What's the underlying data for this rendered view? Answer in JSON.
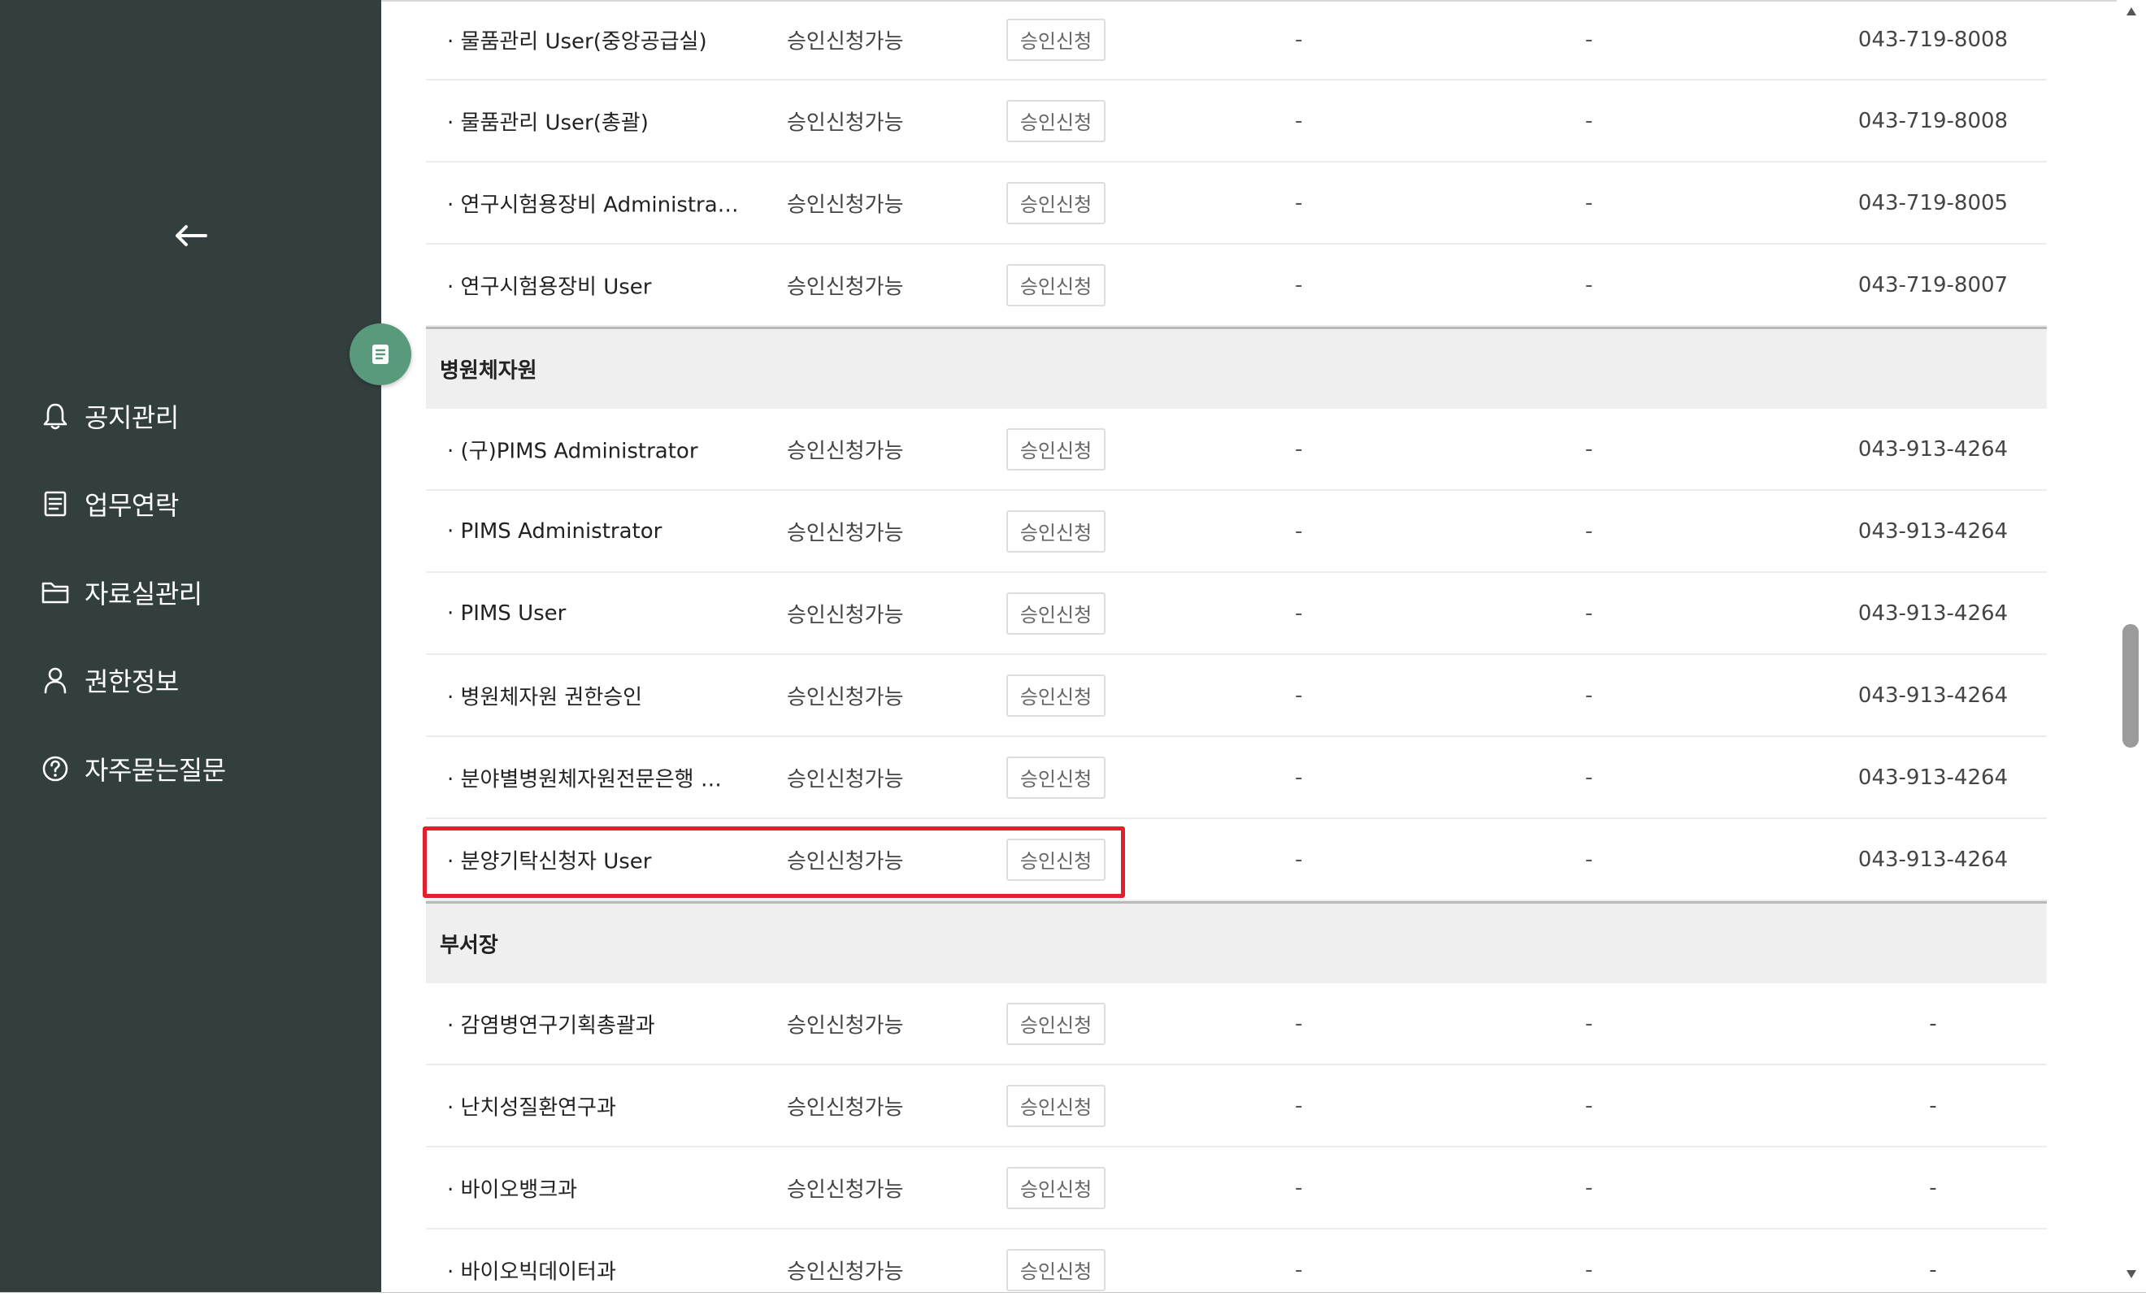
{
  "sidebar": {
    "menu": [
      {
        "label": "공지관리",
        "icon": "bell-icon"
      },
      {
        "label": "업무연락",
        "icon": "document-icon"
      },
      {
        "label": "자료실관리",
        "icon": "folder-icon"
      },
      {
        "label": "권한정보",
        "icon": "user-icon"
      },
      {
        "label": "자주묻는질문",
        "icon": "question-circle-icon"
      }
    ]
  },
  "table": {
    "rows": [
      {
        "type": "item",
        "name": "· 물품관리 User(중앙공급실)",
        "status": "승인신청가능",
        "button": "승인신청",
        "d1": "-",
        "d2": "-",
        "phone": "043-719-8008"
      },
      {
        "type": "item",
        "name": "· 물품관리 User(총괄)",
        "status": "승인신청가능",
        "button": "승인신청",
        "d1": "-",
        "d2": "-",
        "phone": "043-719-8008"
      },
      {
        "type": "item",
        "name": "· 연구시험용장비 Administra…",
        "status": "승인신청가능",
        "button": "승인신청",
        "d1": "-",
        "d2": "-",
        "phone": "043-719-8005"
      },
      {
        "type": "item",
        "name": "· 연구시험용장비 User",
        "status": "승인신청가능",
        "button": "승인신청",
        "d1": "-",
        "d2": "-",
        "phone": "043-719-8007"
      },
      {
        "type": "group",
        "name": "병원체자원"
      },
      {
        "type": "item",
        "name": "· (구)PIMS Administrator",
        "status": "승인신청가능",
        "button": "승인신청",
        "d1": "-",
        "d2": "-",
        "phone": "043-913-4264"
      },
      {
        "type": "item",
        "name": "· PIMS Administrator",
        "status": "승인신청가능",
        "button": "승인신청",
        "d1": "-",
        "d2": "-",
        "phone": "043-913-4264"
      },
      {
        "type": "item",
        "name": "· PIMS User",
        "status": "승인신청가능",
        "button": "승인신청",
        "d1": "-",
        "d2": "-",
        "phone": "043-913-4264"
      },
      {
        "type": "item",
        "name": "· 병원체자원 권한승인",
        "status": "승인신청가능",
        "button": "승인신청",
        "d1": "-",
        "d2": "-",
        "phone": "043-913-4264"
      },
      {
        "type": "item",
        "name": "· 분야별병원체자원전문은행 …",
        "status": "승인신청가능",
        "button": "승인신청",
        "d1": "-",
        "d2": "-",
        "phone": "043-913-4264"
      },
      {
        "type": "item",
        "name": "· 분양기탁신청자 User",
        "status": "승인신청가능",
        "button": "승인신청",
        "d1": "-",
        "d2": "-",
        "phone": "043-913-4264",
        "highlighted": true
      },
      {
        "type": "group",
        "name": "부서장"
      },
      {
        "type": "item",
        "name": "· 감염병연구기획총괄과",
        "status": "승인신청가능",
        "button": "승인신청",
        "d1": "-",
        "d2": "-",
        "phone": "-"
      },
      {
        "type": "item",
        "name": "· 난치성질환연구과",
        "status": "승인신청가능",
        "button": "승인신청",
        "d1": "-",
        "d2": "-",
        "phone": "-"
      },
      {
        "type": "item",
        "name": "· 바이오뱅크과",
        "status": "승인신청가능",
        "button": "승인신청",
        "d1": "-",
        "d2": "-",
        "phone": "-"
      },
      {
        "type": "item",
        "name": "· 바이오빅데이터과",
        "status": "승인신청가능",
        "button": "승인신청",
        "d1": "-",
        "d2": "-",
        "phone": "-"
      }
    ]
  },
  "colors": {
    "sidebar_bg": "#333f3f",
    "fab_bg": "#5a9a7c",
    "highlight": "#e0202a",
    "group_bg": "#efefef"
  }
}
